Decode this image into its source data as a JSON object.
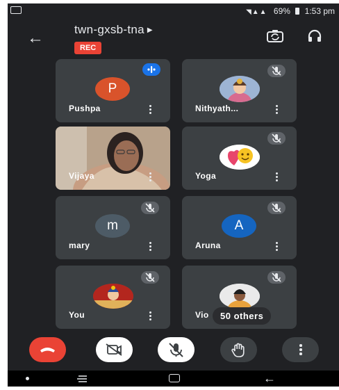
{
  "status": {
    "battery": "69%",
    "time": "1:53 pm"
  },
  "meeting": {
    "code": "twn-gxsb-tna",
    "rec_label": "REC"
  },
  "tiles": [
    {
      "name": "Pushpa",
      "initial": "P",
      "avatar_color": "#d9532b"
    },
    {
      "name": "Nithyath..."
    },
    {
      "name": "Vijaya"
    },
    {
      "name": "Yoga"
    },
    {
      "name": "mary",
      "initial": "m",
      "avatar_color": "#4d5b66"
    },
    {
      "name": "Aruna",
      "initial": "A",
      "avatar_color": "#1565c0"
    },
    {
      "name": "You"
    },
    {
      "name": "Vio",
      "others_label": "50 others"
    }
  ],
  "icons": {
    "back": "arrow-left-icon",
    "switch_camera": "camera-switch-icon",
    "audio": "headphones-icon",
    "end_call": "phone-hangup-icon",
    "camera": "video-off-icon",
    "mic": "mic-off-icon",
    "raise_hand": "hand-icon",
    "more": "more-vert-icon"
  },
  "colors": {
    "end_call": "#ea4335",
    "rec": "#ea4335",
    "tile_bg": "#3c4043",
    "speaking": "#1a73e8"
  }
}
